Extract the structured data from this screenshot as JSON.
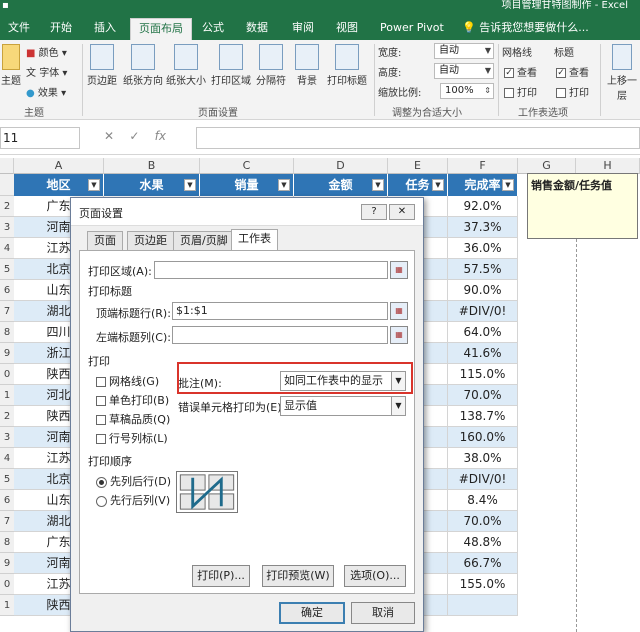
{
  "window": {
    "title": "项目管理甘特图制作 - Excel"
  },
  "tabs": [
    {
      "label": "文件",
      "active": false
    },
    {
      "label": "开始",
      "active": false
    },
    {
      "label": "插入",
      "active": false
    },
    {
      "label": "页面布局",
      "active": true
    },
    {
      "label": "公式",
      "active": false
    },
    {
      "label": "数据",
      "active": false
    },
    {
      "label": "审阅",
      "active": false
    },
    {
      "label": "视图",
      "active": false
    },
    {
      "label": "Power Pivot",
      "active": false
    }
  ],
  "tellme": "告诉我您想要做什么...",
  "ribbon": {
    "theme_group": {
      "label": "主题",
      "theme_btn": "主题",
      "colors": "颜色",
      "fonts": "字体",
      "effects": "效果"
    },
    "page_setup_group": {
      "label": "页面设置",
      "buttons": [
        "页边距",
        "纸张方向",
        "纸张大小",
        "打印区域",
        "分隔符",
        "背景",
        "打印标题"
      ]
    },
    "scale_group": {
      "label": "调整为合适大小",
      "width_label": "宽度:",
      "width_value": "自动",
      "height_label": "高度:",
      "height_value": "自动",
      "scale_label": "缩放比例:",
      "scale_value": "100%"
    },
    "sheet_options_group": {
      "label": "工作表选项",
      "gridlines_header": "网格线",
      "headings_header": "标题",
      "view_label": "查看",
      "print_label": "打印"
    },
    "arrange": {
      "bring_forward": "上移一层"
    }
  },
  "formula_bar": {
    "name_box": "11",
    "cancel": "✕",
    "confirm": "✓",
    "fx": "fx",
    "value": ""
  },
  "grid": {
    "columns": [
      "A",
      "B",
      "C",
      "D",
      "E",
      "F",
      "G",
      "H"
    ],
    "header_row": [
      "地区",
      "水果",
      "销量",
      "金额",
      "任务",
      "完成率"
    ],
    "rows": [
      {
        "num": "2",
        "region": "广东",
        "rate": "92.0%"
      },
      {
        "num": "3",
        "region": "河南",
        "rate": "37.3%"
      },
      {
        "num": "4",
        "region": "江苏",
        "rate": "36.0%"
      },
      {
        "num": "5",
        "region": "北京",
        "rate": "57.5%"
      },
      {
        "num": "6",
        "region": "山东",
        "rate": "90.0%"
      },
      {
        "num": "7",
        "region": "湖北",
        "rate": "#DIV/0!"
      },
      {
        "num": "8",
        "region": "四川",
        "rate": "64.0%"
      },
      {
        "num": "9",
        "region": "浙江",
        "rate": "41.6%"
      },
      {
        "num": "0",
        "region": "陕西",
        "rate": "115.0%"
      },
      {
        "num": "1",
        "region": "河北",
        "rate": "70.0%"
      },
      {
        "num": "2",
        "region": "陕西",
        "rate": "138.7%"
      },
      {
        "num": "3",
        "region": "河南",
        "rate": "160.0%"
      },
      {
        "num": "4",
        "region": "江苏",
        "rate": "38.0%"
      },
      {
        "num": "5",
        "region": "北京",
        "rate": "#DIV/0!"
      },
      {
        "num": "6",
        "region": "山东",
        "rate": "8.4%"
      },
      {
        "num": "7",
        "region": "湖北",
        "rate": "70.0%"
      },
      {
        "num": "8",
        "region": "广东",
        "rate": "48.8%"
      },
      {
        "num": "9",
        "region": "河南",
        "rate": "66.7%"
      },
      {
        "num": "0",
        "region": "江苏",
        "rate": "155.0%"
      },
      {
        "num": "1",
        "region": "陕西",
        "rate": ""
      }
    ],
    "comment": "销售金额/任务值"
  },
  "dialog": {
    "title": "页面设置",
    "help": "?",
    "close": "✕",
    "tabs": [
      "页面",
      "页边距",
      "页眉/页脚",
      "工作表"
    ],
    "print_area_label": "打印区域(A):",
    "print_area_value": "",
    "print_titles_label": "打印标题",
    "top_rows_label": "顶端标题行(R):",
    "top_rows_value": "$1:$1",
    "left_cols_label": "左端标题列(C):",
    "left_cols_value": "",
    "print_section": "打印",
    "options": [
      {
        "label": "网格线(G)",
        "checked": false
      },
      {
        "label": "单色打印(B)",
        "checked": false
      },
      {
        "label": "草稿品质(Q)",
        "checked": false
      },
      {
        "label": "行号列标(L)",
        "checked": false
      }
    ],
    "comments_label": "批注(M):",
    "comments_value": "如同工作表中的显示",
    "errors_label": "错误单元格打印为(E):",
    "errors_value": "显示值",
    "order_section": "打印顺序",
    "order_options": [
      {
        "label": "先列后行(D)",
        "selected": true
      },
      {
        "label": "先行后列(V)",
        "selected": false
      }
    ],
    "buttons": {
      "print": "打印(P)...",
      "preview": "打印预览(W)",
      "options": "选项(O)...",
      "ok": "确定",
      "cancel": "取消"
    }
  }
}
